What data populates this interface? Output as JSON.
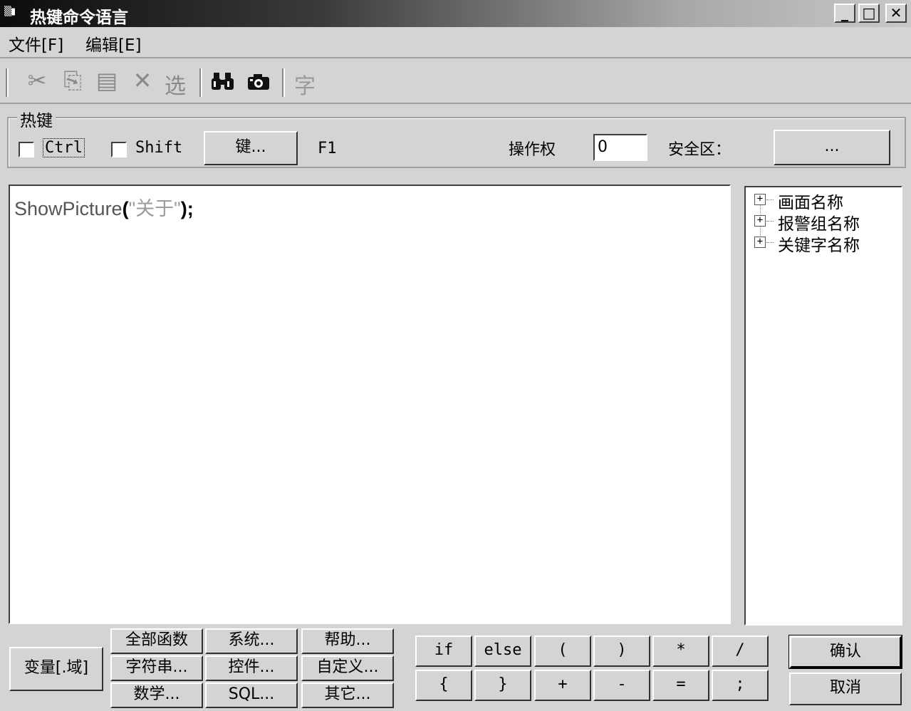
{
  "window": {
    "title": "热键命令语言",
    "app_icon": "app-icon"
  },
  "caption_buttons": {
    "minimize": "_",
    "maximize": "□",
    "close": "✕"
  },
  "menu": {
    "file": "文件[F]",
    "edit": "编辑[E]"
  },
  "toolbar": {
    "cut_icon": "✂",
    "copy_icon": "⎘",
    "paste_icon": "▤",
    "delete_icon": "✕",
    "select_label": "选",
    "find_icon": "binoculars",
    "camera_icon": "camera",
    "font_label": "字"
  },
  "hotkey": {
    "group_title": "热键",
    "ctrl_label": "Ctrl",
    "ctrl_checked": false,
    "shift_label": "Shift",
    "shift_checked": false,
    "key_button": "键...",
    "key_value": "F1",
    "permission_label": "操作权",
    "permission_value": "0",
    "security_label": "安全区：",
    "security_button": "..."
  },
  "editor": {
    "code_func": "ShowPicture",
    "code_open": "(",
    "code_string": "\"关于\"",
    "code_close": ");"
  },
  "tree": {
    "items": [
      {
        "label": "画面名称"
      },
      {
        "label": "报警组名称"
      },
      {
        "label": "关键字名称"
      }
    ]
  },
  "functions": {
    "variable": "变量[.域]",
    "all_functions": "全部函数",
    "system": "系统...",
    "help": "帮助...",
    "string": "字符串...",
    "control": "控件...",
    "custom": "自定义...",
    "math": "数学...",
    "sql": "SQL...",
    "other": "其它..."
  },
  "operators": {
    "row1": [
      "if",
      "else",
      "(",
      ")",
      "*",
      "/"
    ],
    "row2": [
      "{",
      "}",
      "+",
      "-",
      "=",
      ";"
    ]
  },
  "dialog": {
    "ok": "确认",
    "cancel": "取消"
  }
}
